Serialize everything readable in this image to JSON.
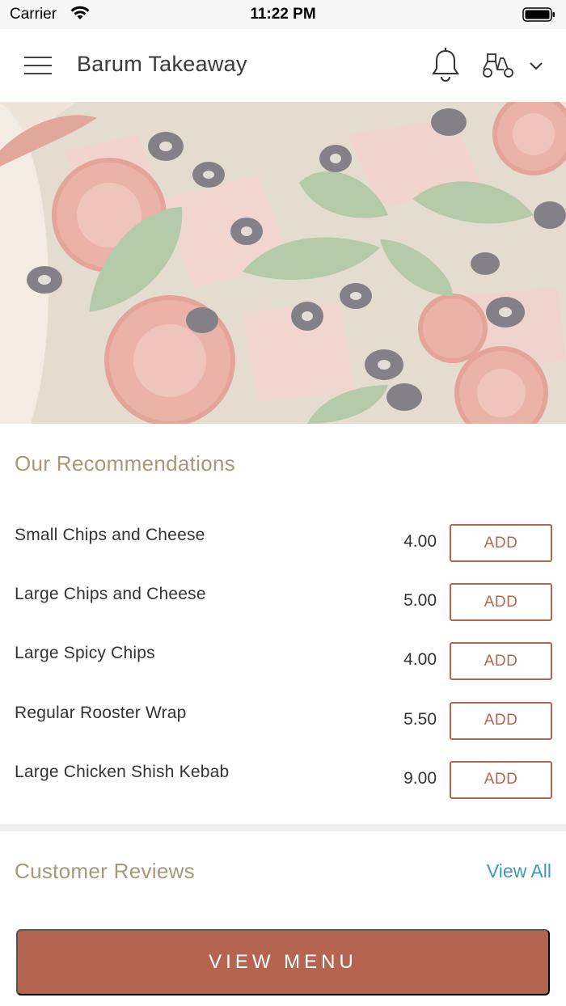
{
  "status_bar": {
    "carrier": "Carrier",
    "time": "11:22 PM",
    "wifi_icon": "wifi-icon",
    "battery_icon": "battery-icon"
  },
  "header": {
    "title": "Barum Takeaway",
    "menu_icon": "hamburger-icon",
    "notification_icon": "bell-icon",
    "delivery_icon": "scooter-icon",
    "dropdown_icon": "chevron-down-icon"
  },
  "hero": {
    "image_subject": "pizza"
  },
  "recommendations": {
    "title": "Our Recommendations",
    "items": [
      {
        "name": "Small Chips and Cheese",
        "price": "4.00",
        "button": "ADD"
      },
      {
        "name": "Large Chips and Cheese",
        "price": "5.00",
        "button": "ADD"
      },
      {
        "name": "Large Spicy Chips",
        "price": "4.00",
        "button": "ADD"
      },
      {
        "name": "Regular Rooster Wrap",
        "price": "5.50",
        "button": "ADD"
      },
      {
        "name": "Large Chicken Shish Kebab",
        "price": "9.00",
        "button": "ADD"
      }
    ]
  },
  "reviews": {
    "title": "Customer Reviews",
    "view_all": "View All"
  },
  "footer": {
    "view_menu": "VIEW MENU"
  },
  "colors": {
    "accent": "#b5654f",
    "section_title": "#a89877",
    "link": "#3a9ab8"
  }
}
